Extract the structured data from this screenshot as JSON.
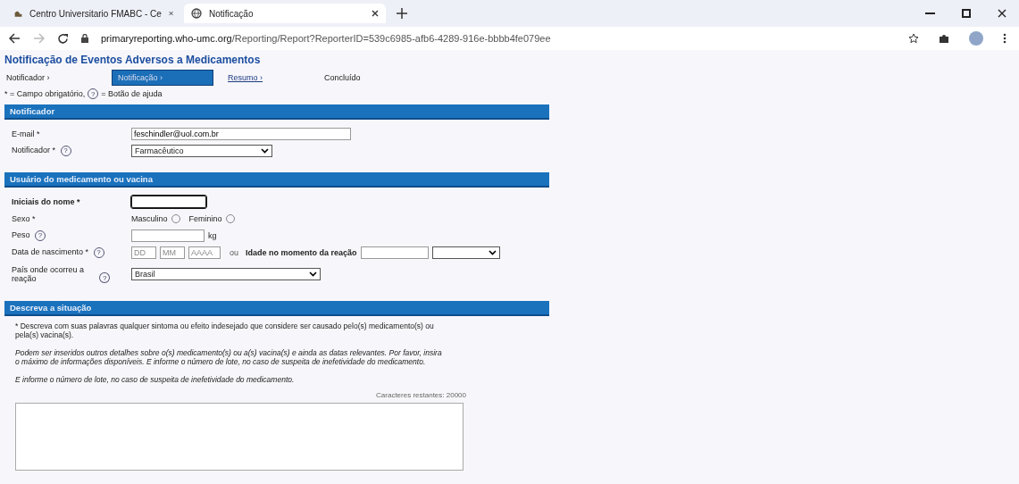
{
  "browser": {
    "tabs": [
      {
        "title": "Centro Universitario FMABC - Ce",
        "selected": false
      },
      {
        "title": "Notificação",
        "selected": true
      }
    ],
    "url_host": "primaryreporting.who-umc.org",
    "url_path": "/Reporting/Report?ReporterID=539c6985-afb6-4289-916e-bbbb4fe079ee"
  },
  "page": {
    "title": "Notificação de Eventos Adversos a Medicamentos",
    "steps": [
      {
        "label": "Notificador ›",
        "selected": false
      },
      {
        "label": "Notificação ›",
        "selected": true
      },
      {
        "label": "Resumo ›",
        "selected": false,
        "link": true
      },
      {
        "label": "Concluído",
        "selected": false
      }
    ],
    "legend": {
      "required": "* = Campo obrigatório,",
      "help_icon": "?",
      "help": "= Botão de ajuda"
    },
    "sections": [
      {
        "title": "Notificador",
        "rows": [
          {
            "kind": "text",
            "label": "E-mail *",
            "value": "feschindler@uol.com.br"
          },
          {
            "kind": "select",
            "label": "Notificador *",
            "help": "?",
            "value": "Farmacêutico"
          }
        ]
      },
      {
        "title": "Usuário do medicamento ou vacina",
        "rows": [
          {
            "kind": "initials",
            "label": "Iniciais do nome *",
            "focused": true
          },
          {
            "kind": "radio",
            "label": "Sexo *",
            "options": [
              {
                "label": "Masculino",
                "selected": false
              },
              {
                "label": "Feminino",
                "selected": false
              }
            ]
          },
          {
            "kind": "weight",
            "label": "Peso",
            "help": "?",
            "unit": "kg"
          },
          {
            "kind": "date",
            "label": "Data de nascimento *",
            "help": "?",
            "placeholders": [
              "DD",
              "MM",
              "AAAA"
            ],
            "or": "ou",
            "age_label": "Idade no momento da reação"
          },
          {
            "kind": "select",
            "label": "País onde ocorreu a reação",
            "help": "?",
            "value": "Brasil"
          }
        ]
      },
      {
        "title": "Descreva a situação",
        "rows": [
          {
            "kind": "description",
            "prompt": "* Descreva com suas palavras qualquer sintoma ou efeito indesejado que considere ser causado pelo(s) medicamento(s) ou pela(s) vacina(s).",
            "hint": "Podem ser inseridos outros detalhes sobre o(s) medicamento(s) ou a(s) vacina(s) e ainda as datas relevantes. Por favor, insira o máximo de informações disponíveis. E informe o número de lote, no caso de suspeita de inefetividade do medicamento.",
            "hint2": "E informe o número de lote, no caso de suspeita de inefetividade do medicamento.",
            "counter": "Caracteres restantes: 20000"
          }
        ]
      }
    ]
  }
}
